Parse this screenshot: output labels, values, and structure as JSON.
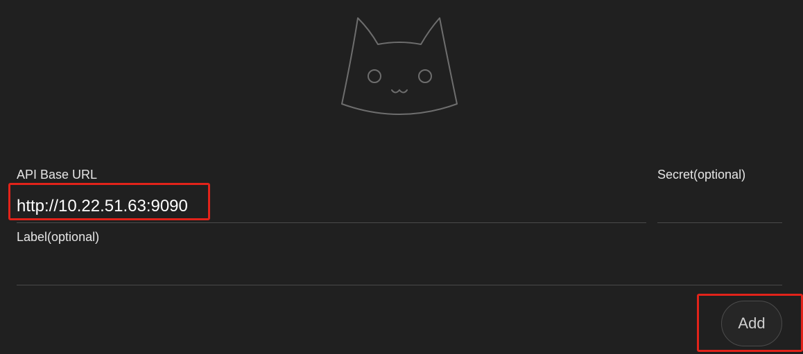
{
  "logo": {
    "icon": "cat-face-icon",
    "stroke_color": "#6e6e6e"
  },
  "form": {
    "api_base_url": {
      "label": "API Base URL",
      "value": "http://10.22.51.63:9090"
    },
    "secret": {
      "label": "Secret(optional)",
      "value": ""
    },
    "label_field": {
      "label": "Label(optional)",
      "value": ""
    },
    "add_button_label": "Add"
  },
  "annotations": {
    "highlight_color": "#e2231a"
  }
}
